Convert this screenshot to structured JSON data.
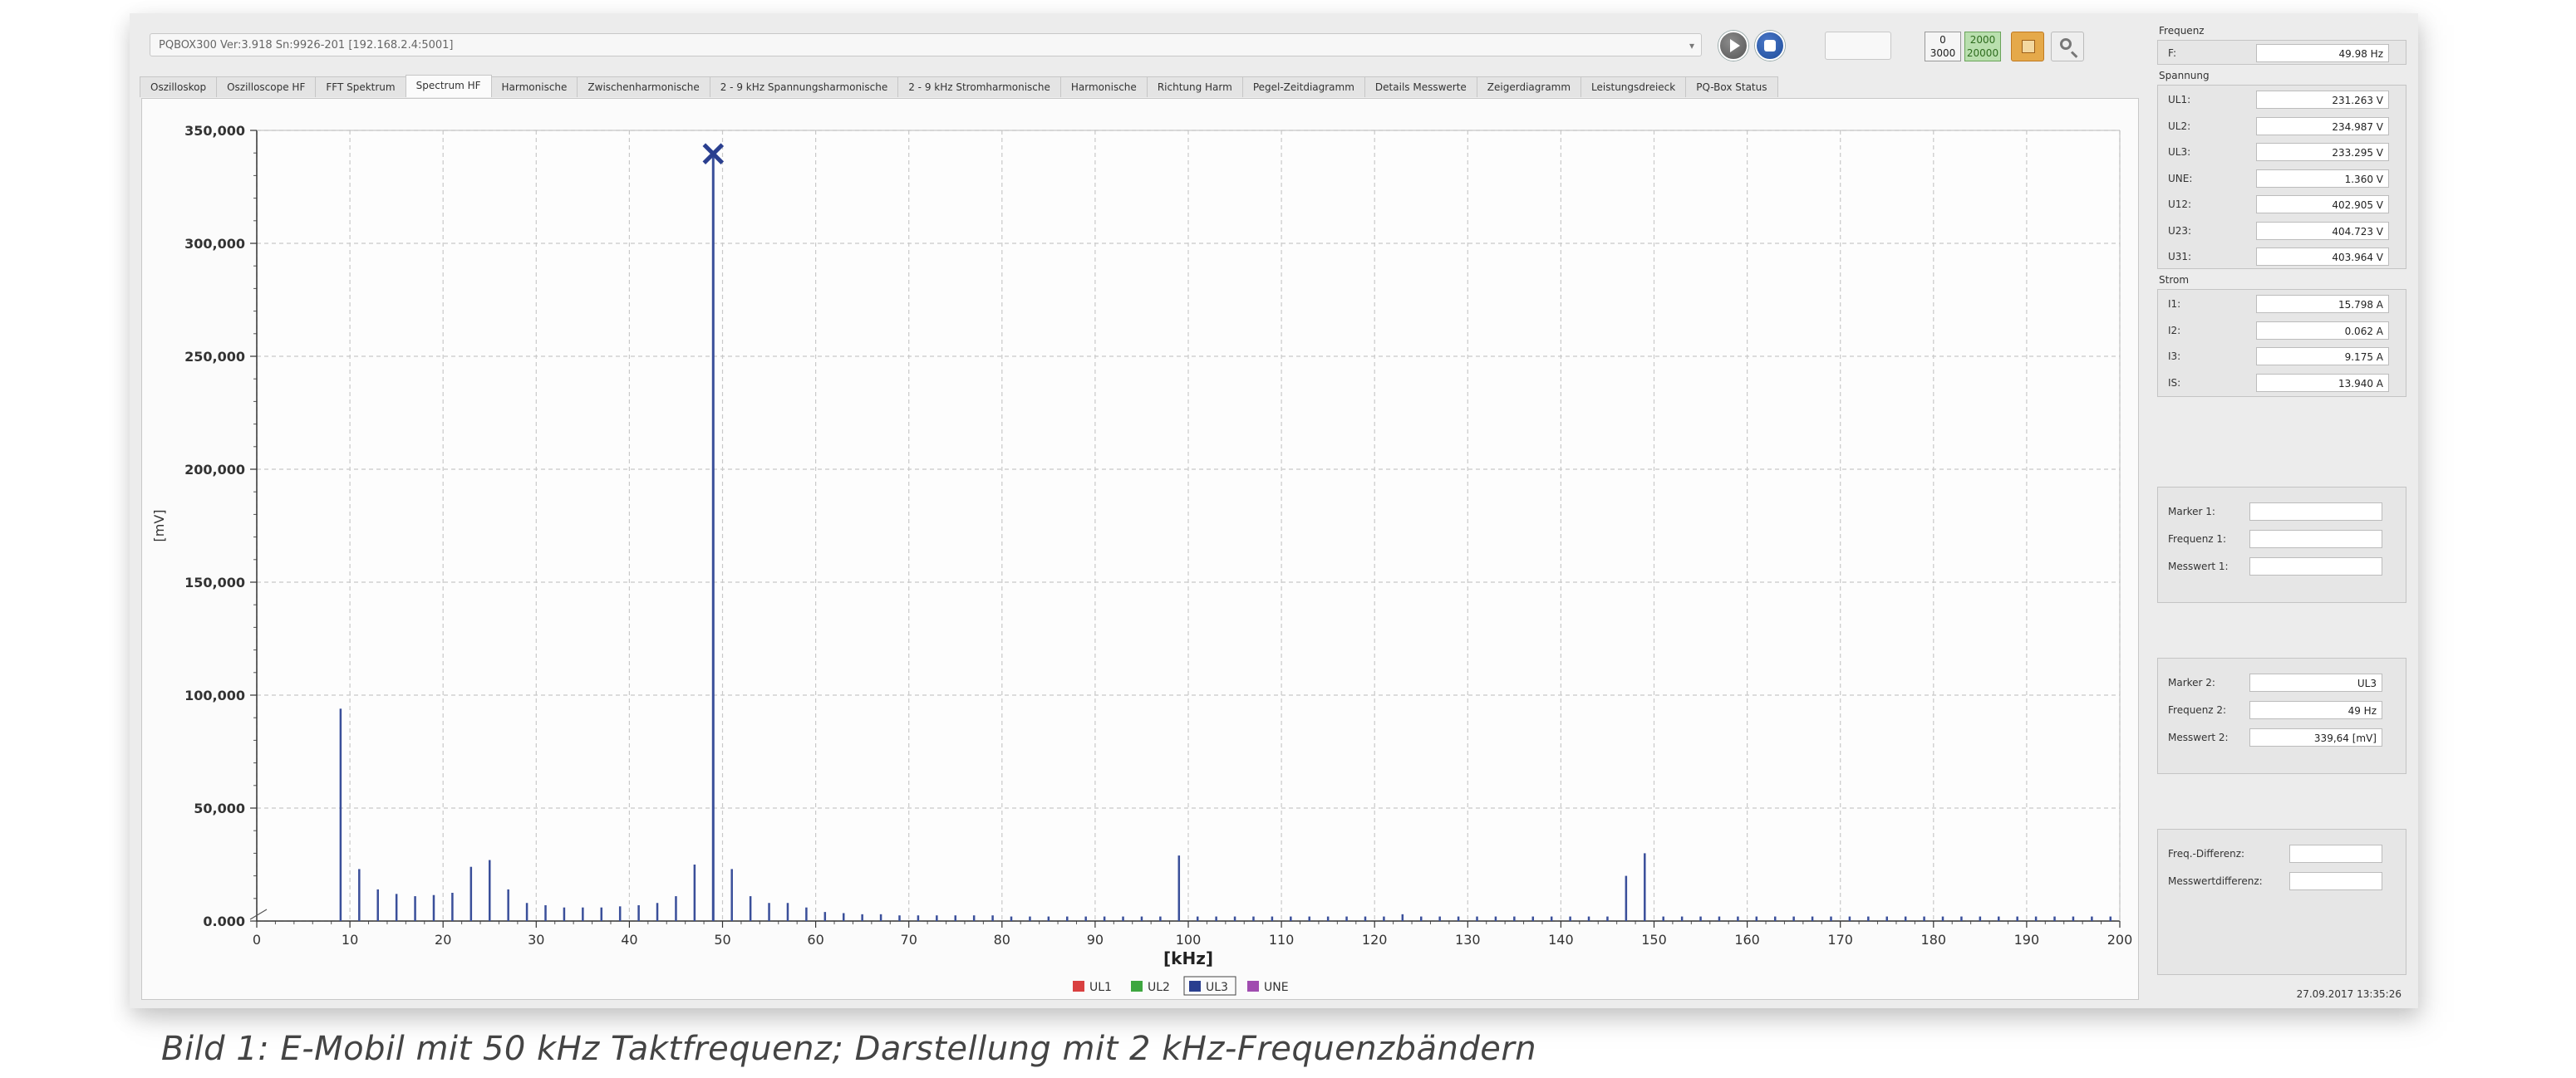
{
  "window": {
    "device_label": "PQBOX300 Ver:3.918 Sn:9926-201 [192.168.2.4:5001]",
    "range_1": [
      "0",
      "3000"
    ],
    "range_2": [
      "2000",
      "20000"
    ],
    "icons": [
      "chevron-down-icon",
      "play-icon",
      "stop-icon",
      "export-icon",
      "zoom-icon"
    ]
  },
  "tabs": [
    {
      "label": "Oszilloskop",
      "active": false
    },
    {
      "label": "Oszilloscope HF",
      "active": false
    },
    {
      "label": "FFT Spektrum",
      "active": false
    },
    {
      "label": "Spectrum HF",
      "active": true
    },
    {
      "label": "Harmonische",
      "active": false
    },
    {
      "label": "Zwischenharmonische",
      "active": false
    },
    {
      "label": "2 - 9 kHz Spannungsharmonische",
      "active": false
    },
    {
      "label": "2 - 9 kHz Stromharmonische",
      "active": false
    },
    {
      "label": "Harmonische",
      "active": false
    },
    {
      "label": "Richtung Harm",
      "active": false
    },
    {
      "label": "Pegel-Zeitdiagramm",
      "active": false
    },
    {
      "label": "Details Messwerte",
      "active": false
    },
    {
      "label": "Zeigerdiagramm",
      "active": false
    },
    {
      "label": "Leistungsdreieck",
      "active": false
    },
    {
      "label": "PQ-Box Status",
      "active": false
    }
  ],
  "chart_data": {
    "type": "bar",
    "xlabel": "[kHz]",
    "ylabel": "[mV]",
    "xlim": [
      0,
      200
    ],
    "ylim": [
      0,
      350000
    ],
    "xticks": [
      0,
      10,
      20,
      30,
      40,
      50,
      60,
      70,
      80,
      90,
      100,
      110,
      120,
      130,
      140,
      150,
      160,
      170,
      180,
      190,
      200
    ],
    "yticks": [
      0,
      50000,
      100000,
      150000,
      200000,
      250000,
      300000,
      350000
    ],
    "ytick_labels": [
      "0.000",
      "50,000",
      "100,000",
      "150,000",
      "200,000",
      "250,000",
      "300,000",
      "350,000"
    ],
    "grid": true,
    "legend_position": "bottom-center",
    "series": [
      {
        "name": "UL3",
        "color": "#3a4f9a",
        "x": [
          9,
          11,
          13,
          15,
          17,
          19,
          21,
          23,
          25,
          27,
          29,
          31,
          33,
          35,
          37,
          39,
          41,
          43,
          45,
          47,
          49,
          51,
          53,
          55,
          57,
          59,
          61,
          63,
          65,
          67,
          69,
          71,
          73,
          75,
          77,
          79,
          81,
          83,
          85,
          87,
          89,
          91,
          93,
          95,
          97,
          99,
          101,
          103,
          105,
          107,
          109,
          111,
          113,
          115,
          117,
          119,
          121,
          123,
          125,
          127,
          129,
          131,
          133,
          135,
          137,
          139,
          141,
          143,
          145,
          147,
          149,
          151,
          153,
          155,
          157,
          159,
          161,
          163,
          165,
          167,
          169,
          171,
          173,
          175,
          177,
          179,
          181,
          183,
          185,
          187,
          189,
          191,
          193,
          195,
          197,
          199
        ],
        "values": [
          94000,
          23000,
          14000,
          12000,
          11000,
          11500,
          12500,
          24000,
          27000,
          14000,
          8000,
          7000,
          6000,
          6000,
          6000,
          6500,
          7000,
          8000,
          11000,
          25000,
          339640,
          23000,
          11000,
          8000,
          8000,
          6000,
          4000,
          3500,
          3000,
          3000,
          2500,
          2500,
          2500,
          2500,
          2500,
          2500,
          2000,
          2000,
          2000,
          2000,
          2000,
          2000,
          2000,
          2000,
          2000,
          29000,
          2000,
          2000,
          2000,
          2000,
          2000,
          2000,
          2000,
          2000,
          2000,
          2000,
          2000,
          3000,
          2000,
          2000,
          2000,
          2000,
          2000,
          2000,
          2000,
          2000,
          2000,
          2000,
          2000,
          20000,
          30000,
          2000,
          2000,
          2000,
          2000,
          2000,
          2000,
          2000,
          2000,
          2000,
          2000,
          2000,
          2000,
          2000,
          2000,
          2000,
          2000,
          2000,
          2000,
          2000,
          2000,
          2000,
          2000,
          2000,
          2000,
          2000
        ]
      }
    ],
    "legend": [
      {
        "name": "UL1",
        "color": "#d94040"
      },
      {
        "name": "UL2",
        "color": "#3ea640"
      },
      {
        "name": "UL3",
        "color": "#2a3f8f",
        "selected": true
      },
      {
        "name": "UNE",
        "color": "#a04cb0"
      }
    ],
    "marker": {
      "x": 49,
      "y": 339640,
      "symbol": "x"
    }
  },
  "side": {
    "frequenz": {
      "title": "Frequenz",
      "rows": [
        {
          "label": "F:",
          "value": "49.98 Hz"
        }
      ]
    },
    "spannung": {
      "title": "Spannung",
      "rows": [
        {
          "label": "UL1:",
          "value": "231.263 V"
        },
        {
          "label": "UL2:",
          "value": "234.987 V"
        },
        {
          "label": "UL3:",
          "value": "233.295 V"
        },
        {
          "label": "UNE:",
          "value": "1.360 V"
        },
        {
          "label": "U12:",
          "value": "402.905 V"
        },
        {
          "label": "U23:",
          "value": "404.723 V"
        },
        {
          "label": "U31:",
          "value": "403.964 V"
        }
      ]
    },
    "strom": {
      "title": "Strom",
      "rows": [
        {
          "label": "I1:",
          "value": "15.798 A"
        },
        {
          "label": "I2:",
          "value": "0.062 A"
        },
        {
          "label": "I3:",
          "value": "9.175 A"
        },
        {
          "label": "IS:",
          "value": "13.940 A"
        }
      ]
    },
    "marker1": {
      "rows": [
        {
          "label": "Marker 1:",
          "value": ""
        },
        {
          "label": "Frequenz 1:",
          "value": ""
        },
        {
          "label": "Messwert 1:",
          "value": ""
        }
      ]
    },
    "marker2": {
      "rows": [
        {
          "label": "Marker 2:",
          "value": "UL3"
        },
        {
          "label": "Frequenz 2:",
          "value": "49 Hz"
        },
        {
          "label": "Messwert 2:",
          "value": "339,64 [mV]"
        }
      ]
    },
    "diff": {
      "rows": [
        {
          "label": "Freq.-Differenz:",
          "value": ""
        },
        {
          "label": "Messwertdifferenz:",
          "value": ""
        }
      ]
    },
    "timestamp": "27.09.2017 13:35:26"
  },
  "caption": "Bild 1: E-Mobil mit 50 kHz Taktfrequenz; Darstellung mit 2 kHz-Frequenzbändern"
}
